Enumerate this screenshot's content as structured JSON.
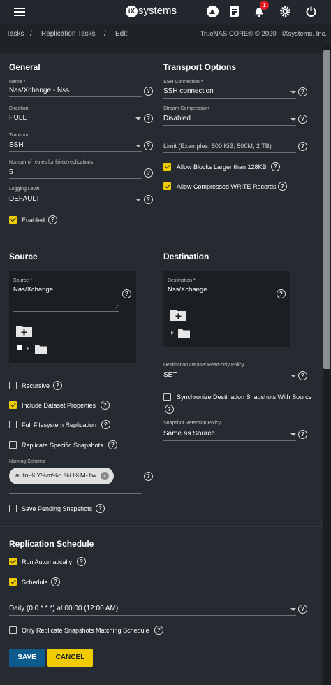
{
  "header": {
    "brand": "systems",
    "notification_count": "1"
  },
  "breadcrumb": {
    "items": [
      "Tasks",
      "Replication Tasks",
      "Edit"
    ],
    "separator": "/",
    "copyright": "TrueNAS CORE® © 2020 - iXsystems, Inc."
  },
  "general": {
    "title": "General",
    "name_label": "Name *",
    "name_value": "Nas/Xchange - Nss",
    "direction_label": "Direction",
    "direction_value": "PULL",
    "transport_label": "Transport",
    "transport_value": "SSH",
    "retries_label": "Number of retries for failed replications",
    "retries_value": "5",
    "logging_label": "Logging Level",
    "logging_value": "DEFAULT",
    "enabled_label": "Enabled"
  },
  "transport": {
    "title": "Transport Options",
    "ssh_label": "SSH Connection *",
    "ssh_value": "SSH connection",
    "compression_label": "Stream Compression",
    "compression_value": "Disabled",
    "limit_placeholder": "Limit (Examples: 500 KiB, 500M, 2 TB)",
    "large_blocks_label": "Allow Blocks Larger than 128KB",
    "compressed_label": "Allow Compressed WRITE Records"
  },
  "source": {
    "title": "Source",
    "source_label": "Source *",
    "source_value": "Nas/Xchange",
    "recursive_label": "Recursive",
    "include_props_label": "Include Dataset Properties",
    "full_fs_label": "Full Filesystem Replication",
    "specific_snap_label": "Replicate Specific Snapshots",
    "naming_label": "Naming Schema",
    "naming_chip": "auto-%Y%m%d.%H%M-1w",
    "save_pending_label": "Save Pending Snapshots"
  },
  "destination": {
    "title": "Destination",
    "dest_label": "Destination *",
    "dest_value": "Nss/Xchange",
    "readonly_label": "Destination Dataset Read-only Policy",
    "readonly_value": "SET",
    "sync_label": "Synchronize Destination Snapshots With Source",
    "retention_label": "Snapshot Retention Policy",
    "retention_value": "Same as Source"
  },
  "schedule": {
    "title": "Replication Schedule",
    "run_auto_label": "Run Automatically",
    "schedule_label": "Schedule",
    "schedule_value": "Daily (0 0 * * *) at 00:00 (12:00 AM)",
    "only_matching_label": "Only Replicate Snapshots Matching Schedule"
  },
  "actions": {
    "save": "SAVE",
    "cancel": "CANCEL"
  },
  "colors": {
    "accent_yellow": "#f0cb00",
    "save_blue": "#0d5b8c",
    "background": "#1e2328",
    "card": "#262b31"
  },
  "icons": {
    "help": "?",
    "menu": "hamburger-icon",
    "folder": "folder-icon"
  }
}
